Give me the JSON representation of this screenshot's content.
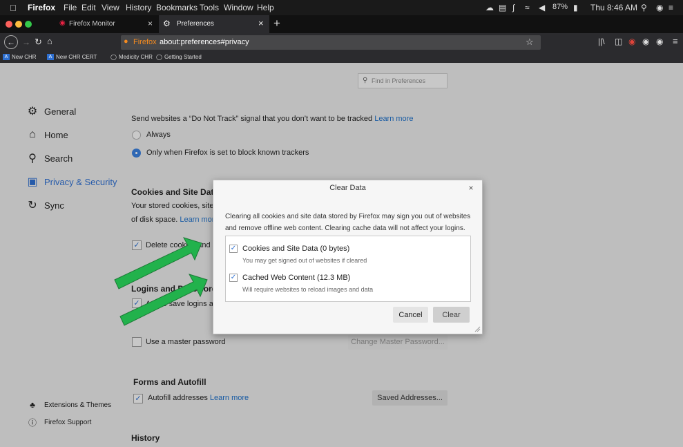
{
  "menubar": {
    "apple": "",
    "app_name": "Firefox",
    "items": [
      "File",
      "Edit",
      "View",
      "History",
      "Bookmarks",
      "Tools",
      "Window",
      "Help"
    ],
    "battery": "87%",
    "clock": "Thu 8:46 AM"
  },
  "tabs": [
    {
      "title": "Firefox Monitor",
      "close": "×"
    },
    {
      "title": "Preferences",
      "close": "×"
    }
  ],
  "new_tab": "+",
  "nav": {
    "identity_label": "Firefox",
    "url": "about:preferences#privacy",
    "star": "☆"
  },
  "bookmarks": [
    {
      "label": "New CHR",
      "icon": "AI"
    },
    {
      "label": "New CHR CERT",
      "icon": "AI"
    },
    {
      "label": "Medicity CHR",
      "icon": "globe"
    },
    {
      "label": "Getting Started",
      "icon": "globe"
    }
  ],
  "search": {
    "placeholder": "Find in Preferences"
  },
  "sidebar": {
    "items": [
      {
        "label": "General",
        "icon": "gear-icon"
      },
      {
        "label": "Home",
        "icon": "home-icon"
      },
      {
        "label": "Search",
        "icon": "search-icon"
      },
      {
        "label": "Privacy & Security",
        "icon": "lock-icon",
        "active": true
      },
      {
        "label": "Sync",
        "icon": "sync-icon"
      }
    ],
    "footer": [
      {
        "label": "Extensions & Themes",
        "icon": "puzzle-icon"
      },
      {
        "label": "Firefox Support",
        "icon": "help-icon"
      }
    ]
  },
  "main": {
    "dnt_text": "Send websites a “Do Not Track” signal that you don’t want to be tracked",
    "dnt_learn": "Learn more",
    "dnt_always": "Always",
    "dnt_only": "Only when Firefox is set to block known trackers",
    "cookies_heading": "Cookies and Site Data",
    "cookies_desc1": "Your stored cookies, site data, and cache are currently using",
    "cookies_desc2": "of disk space.",
    "cookies_learn": "Learn more",
    "delete_cookies": "Delete cookies and site data when Firefox is closed",
    "logins_heading": "Logins and Passwords",
    "logins_ask": "Ask to save logins and passwords for websites",
    "master_pw": "Use a master password",
    "change_master": "Change Master Password...",
    "forms_heading": "Forms and Autofill",
    "autofill": "Autofill addresses",
    "autofill_learn": "Learn more",
    "saved_addresses": "Saved Addresses...",
    "history_heading": "History"
  },
  "dialog": {
    "title": "Clear Data",
    "close": "×",
    "description": "Clearing all cookies and site data stored by Firefox may sign you out of websites and remove offline web content. Clearing cache data will not affect your logins.",
    "options": [
      {
        "label": "Cookies and Site Data (0 bytes)",
        "sub": "You may get signed out of websites if cleared",
        "checked": true
      },
      {
        "label": "Cached Web Content (12.3 MB)",
        "sub": "Will require websites to reload images and data",
        "checked": true
      }
    ],
    "cancel": "Cancel",
    "clear": "Clear"
  },
  "colors": {
    "accent": "#3a7fdc",
    "link": "#1e6fc7",
    "arrow": "#22b24c"
  }
}
